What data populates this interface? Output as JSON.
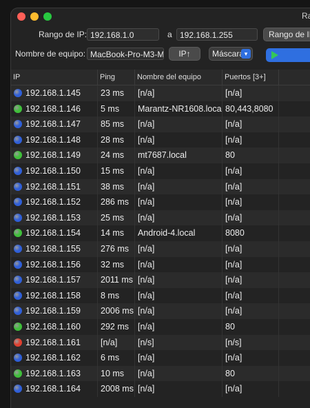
{
  "window": {
    "title": "Ra"
  },
  "controls": {
    "ip_range_label": "Rango de IP:",
    "ip_from": "192.168.1.0",
    "to_label": "a",
    "ip_to": "192.168.1.255",
    "range_button": "Rango de IP",
    "hostname_label": "Nombre de equipo:",
    "hostname_value": "MacBook-Pro-M3-M",
    "ip_button": "IP↑",
    "mask_label": "Máscara"
  },
  "table": {
    "headers": [
      "IP",
      "Ping",
      "Nombre del equipo",
      "Puertos [3+]"
    ],
    "rows": [
      {
        "ip": "192.168.1.145",
        "ping": "23 ms",
        "name": "[n/a]",
        "ports": "[n/a]",
        "status": "blue"
      },
      {
        "ip": "192.168.1.146",
        "ping": "5 ms",
        "name": "Marantz-NR1608.local",
        "ports": "80,443,8080",
        "status": "green"
      },
      {
        "ip": "192.168.1.147",
        "ping": "85 ms",
        "name": "[n/a]",
        "ports": "[n/a]",
        "status": "blue"
      },
      {
        "ip": "192.168.1.148",
        "ping": "28 ms",
        "name": "[n/a]",
        "ports": "[n/a]",
        "status": "blue"
      },
      {
        "ip": "192.168.1.149",
        "ping": "24 ms",
        "name": "mt7687.local",
        "ports": "80",
        "status": "green"
      },
      {
        "ip": "192.168.1.150",
        "ping": "15 ms",
        "name": "[n/a]",
        "ports": "[n/a]",
        "status": "blue"
      },
      {
        "ip": "192.168.1.151",
        "ping": "38 ms",
        "name": "[n/a]",
        "ports": "[n/a]",
        "status": "blue"
      },
      {
        "ip": "192.168.1.152",
        "ping": "286 ms",
        "name": "[n/a]",
        "ports": "[n/a]",
        "status": "blue"
      },
      {
        "ip": "192.168.1.153",
        "ping": "25 ms",
        "name": "[n/a]",
        "ports": "[n/a]",
        "status": "blue"
      },
      {
        "ip": "192.168.1.154",
        "ping": "14 ms",
        "name": "Android-4.local",
        "ports": "8080",
        "status": "green"
      },
      {
        "ip": "192.168.1.155",
        "ping": "276 ms",
        "name": "[n/a]",
        "ports": "[n/a]",
        "status": "blue"
      },
      {
        "ip": "192.168.1.156",
        "ping": "32 ms",
        "name": "[n/a]",
        "ports": "[n/a]",
        "status": "blue"
      },
      {
        "ip": "192.168.1.157",
        "ping": "2011 ms",
        "name": "[n/a]",
        "ports": "[n/a]",
        "status": "blue"
      },
      {
        "ip": "192.168.1.158",
        "ping": "8 ms",
        "name": "[n/a]",
        "ports": "[n/a]",
        "status": "blue"
      },
      {
        "ip": "192.168.1.159",
        "ping": "2006 ms",
        "name": "[n/a]",
        "ports": "[n/a]",
        "status": "blue"
      },
      {
        "ip": "192.168.1.160",
        "ping": "292 ms",
        "name": "[n/a]",
        "ports": "80",
        "status": "green"
      },
      {
        "ip": "192.168.1.161",
        "ping": "[n/a]",
        "name": "[n/s]",
        "ports": "[n/s]",
        "status": "red"
      },
      {
        "ip": "192.168.1.162",
        "ping": "6 ms",
        "name": "[n/a]",
        "ports": "[n/a]",
        "status": "blue"
      },
      {
        "ip": "192.168.1.163",
        "ping": "10 ms",
        "name": "[n/a]",
        "ports": "80",
        "status": "green"
      },
      {
        "ip": "192.168.1.164",
        "ping": "2008 ms",
        "name": "[n/a]",
        "ports": "[n/a]",
        "status": "blue"
      }
    ]
  },
  "colors": {
    "blue": "#2f5fd8",
    "green": "#3fbf3a",
    "red": "#e04030"
  }
}
